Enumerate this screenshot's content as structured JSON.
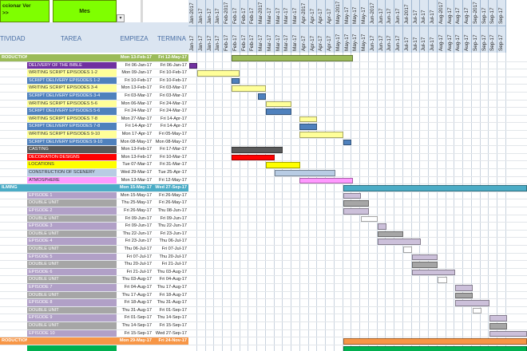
{
  "toolbar": {
    "select_view_label": "ccionar Ver\n>>",
    "view_value": "Mes",
    "dropdown_icon": "chevron-down-icon"
  },
  "columns": {
    "activity": "TIVIDAD",
    "task": "TAREA",
    "start": "EMPIEZA",
    "end": "TERMINA"
  },
  "months": [
    "Jan-2017",
    "Jan-17",
    "Jan-17",
    "Jan-17",
    "Feb-2017",
    "Feb-17",
    "Feb-17",
    "Feb-17",
    "Mar-2017",
    "Mar-17",
    "Mar-17",
    "Mar-17",
    "Mar-17",
    "Apr-2017",
    "Apr-17",
    "Apr-17",
    "Apr-17",
    "May-2017",
    "May-17",
    "May-17",
    "May-17",
    "Jun-2017",
    "Jun-17",
    "Jun-17",
    "Jun-17",
    "Jul-2017",
    "Jul-17",
    "Jul-17",
    "Jul-17",
    "Aug-2017",
    "Aug-17",
    "Aug-17",
    "Aug-17",
    "Sep-2017",
    "Sep-17",
    "Sep-17",
    "Sep-17"
  ],
  "months2": [
    "Jan-17",
    "Jan-17",
    "Jan-17",
    "Jan-17",
    "Feb-17",
    "Feb-17",
    "Feb-17",
    "Feb-17",
    "Mar-17",
    "Mar-17",
    "Mar-17",
    "Mar-17",
    "Mar-17",
    "Apr-17",
    "Apr-17",
    "Apr-17",
    "Apr-17",
    "May-17",
    "May-17",
    "May-17",
    "May-17",
    "Jun-17",
    "Jun-17",
    "Jun-17",
    "Jun-17",
    "Jul-17",
    "Jul-17",
    "Jul-17",
    "Jul-17",
    "Aug-17",
    "Aug-17",
    "Aug-17",
    "Aug-17",
    "Sep-17",
    "Sep-17",
    "Sep-17",
    "Sep-17"
  ],
  "rows": [
    {
      "activity": "RODUCTION",
      "task": "",
      "start": "Mon 13-Feb-17",
      "end": "Fri 12-May-17",
      "kind": "phase",
      "color": "#9bbb59",
      "bar": [
        290,
        442
      ],
      "barColor": "#9bbb59"
    },
    {
      "activity": "",
      "task": "DELIVERY OF THE BIBLE",
      "start": "Fri 06-Jan-17",
      "end": "Fri 06-Jan-17",
      "color": "#7030a0",
      "bar": [
        237,
        247
      ],
      "barColor": "#7030a0"
    },
    {
      "activity": "",
      "task": "WRITING SCRIPT EPISODES 1-2",
      "start": "Mon 09-Jan-17",
      "end": "Fri 10-Feb-17",
      "color": "#ffff99",
      "bar": [
        247,
        300
      ],
      "barColor": "#ffff99"
    },
    {
      "activity": "",
      "task": "SCRIPT DELIVERY EPISODES 1-2",
      "start": "Fri 10-Feb-17",
      "end": "Fri 10-Feb-17",
      "color": "#4f81bd",
      "bar": [
        290,
        300
      ],
      "barColor": "#4f81bd"
    },
    {
      "activity": "",
      "task": "WRITING SCRIPT EPISODES 3-4",
      "start": "Mon 13-Feb-17",
      "end": "Fri 03-Mar-17",
      "color": "#ffff99",
      "bar": [
        290,
        333
      ],
      "barColor": "#ffff99"
    },
    {
      "activity": "",
      "task": "SCRIPT DELIVERY EPISODES 3-4",
      "start": "Fri 03-Mar-17",
      "end": "Fri 03-Mar-17",
      "color": "#4f81bd",
      "bar": [
        323,
        333
      ],
      "barColor": "#4f81bd"
    },
    {
      "activity": "",
      "task": "WRITING SCRIPT EPISODES 5-6",
      "start": "Mon 06-Mar-17",
      "end": "Fri 24-Mar-17",
      "color": "#ffff99",
      "bar": [
        333,
        365
      ],
      "barColor": "#ffff99"
    },
    {
      "activity": "",
      "task": "SCRIPT DELIVERY EPISODES 5-6",
      "start": "Fri 24-Mar-17",
      "end": "Fri 24-Mar-17",
      "color": "#4f81bd",
      "bar": [
        333,
        365
      ],
      "barColor": "#4f81bd"
    },
    {
      "activity": "",
      "task": "WRITING SCRIPT EPISODES 7-8",
      "start": "Mon 27-Mar-17",
      "end": "Fri 14-Apr-17",
      "color": "#ffff99",
      "bar": [
        375,
        397
      ],
      "barColor": "#ffff99"
    },
    {
      "activity": "",
      "task": "SCRIPT DELIVERY EPISODES 7-8",
      "start": "Fri 14-Apr-17",
      "end": "Fri 14-Apr-17",
      "color": "#4f81bd",
      "bar": [
        375,
        397
      ],
      "barColor": "#4f81bd"
    },
    {
      "activity": "",
      "task": "WRITING SCRIPT EPISODES 9-10",
      "start": "Mon 17-Apr-17",
      "end": "Fri 05-May-17",
      "color": "#ffff99",
      "bar": [
        375,
        430
      ],
      "barColor": "#ffff99"
    },
    {
      "activity": "",
      "task": "SCRIPT DELIVERY EPISODES 9-10",
      "start": "Mon 08-May-17",
      "end": "Mon 08-May-17",
      "color": "#4f81bd",
      "bar": [
        430,
        440
      ],
      "barColor": "#4f81bd"
    },
    {
      "activity": "",
      "task": "CASTING",
      "start": "Mon 13-Feb-17",
      "end": "Fri 17-Mar-17",
      "color": "#595959",
      "bar": [
        290,
        354
      ],
      "barColor": "#595959"
    },
    {
      "activity": "",
      "task": "DECORATION DESIGNS",
      "start": "Mon 13-Feb-17",
      "end": "Fri 10-Mar-17",
      "color": "#ff0000",
      "bar": [
        290,
        344
      ],
      "barColor": "#ff0000"
    },
    {
      "activity": "",
      "task": "LOCATIONS",
      "start": "Tue 07-Mar-17",
      "end": "Fri 31-Mar-17",
      "color": "#ffff00",
      "bar": [
        333,
        376
      ],
      "barColor": "#ffff00"
    },
    {
      "activity": "",
      "task": "CONSTRUCTION OF SCENERY",
      "start": "Wed 29-Mar-17",
      "end": "Tue 25-Apr-17",
      "color": "#b8cce4",
      "bar": [
        344,
        420
      ],
      "barColor": "#b8cce4"
    },
    {
      "activity": "",
      "task": "ATMOSPHERE",
      "start": "Mon 13-Mar-17",
      "end": "Fri 12-May-17",
      "color": "#ff99ff",
      "bar": [
        375,
        442
      ],
      "barColor": "#ff99ff"
    },
    {
      "activity": "ILMING",
      "task": "",
      "start": "Mon 15-May-17",
      "end": "Wed 27-Sep-17",
      "kind": "phase",
      "color": "#4bacc6",
      "bar": [
        430,
        660
      ],
      "barColor": "#4bacc6"
    },
    {
      "activity": "",
      "task": "EPISODE 1",
      "start": "Mon 15-May-17",
      "end": "Fri 26-May-17",
      "color": "#b1a0c7",
      "bar": [
        430,
        452
      ],
      "barColor": "#ccc0da"
    },
    {
      "activity": "",
      "task": "DOUBLE UNIT",
      "start": "Thu 25-May-17",
      "end": "Fri 26-May-17",
      "color": "#a6a6a6",
      "bar": [
        430,
        462
      ],
      "barColor": "#a6a6a6"
    },
    {
      "activity": "",
      "task": "EPISODE 2",
      "start": "Fri 26-May-17",
      "end": "Thu 08-Jun-17",
      "color": "#b1a0c7",
      "bar": [
        430,
        462
      ],
      "barColor": "#ccc0da"
    },
    {
      "activity": "",
      "task": "DOUBLE UNIT",
      "start": "Fri 09-Jun-17",
      "end": "Fri 09-Jun-17",
      "color": "#a6a6a6",
      "bar": [
        452,
        473
      ],
      "barColor": "#ffffff"
    },
    {
      "activity": "",
      "task": "EPISODE 3",
      "start": "Fri 09-Jun-17",
      "end": "Thu 22-Jun-17",
      "color": "#b1a0c7",
      "bar": [
        473,
        484
      ],
      "barColor": "#ccc0da"
    },
    {
      "activity": "",
      "task": "DOUBLE UNIT",
      "start": "Thu 22-Jun-17",
      "end": "Fri 23-Jun-17",
      "color": "#a6a6a6",
      "bar": [
        473,
        505
      ],
      "barColor": "#a6a6a6"
    },
    {
      "activity": "",
      "task": "EPISODE 4",
      "start": "Fri 23-Jun-17",
      "end": "Thu 06-Jul-17",
      "color": "#b1a0c7",
      "bar": [
        473,
        527
      ],
      "barColor": "#ccc0da"
    },
    {
      "activity": "",
      "task": "DOUBLE UNIT",
      "start": "Thu 06-Jul-17",
      "end": "Fri 07-Jul-17",
      "color": "#a6a6a6",
      "bar": [
        505,
        516
      ],
      "barColor": "#ffffff"
    },
    {
      "activity": "",
      "task": "EPISODE 5",
      "start": "Fri 07-Jul-17",
      "end": "Thu 20-Jul-17",
      "color": "#b1a0c7",
      "bar": [
        516,
        548
      ],
      "barColor": "#ccc0da"
    },
    {
      "activity": "",
      "task": "DOUBLE UNIT",
      "start": "Thu 20-Jul-17",
      "end": "Fri 21-Jul-17",
      "color": "#a6a6a6",
      "bar": [
        516,
        548
      ],
      "barColor": "#a6a6a6"
    },
    {
      "activity": "",
      "task": "EPISODE 6",
      "start": "Fri 21-Jul-17",
      "end": "Thu 03-Aug-17",
      "color": "#b1a0c7",
      "bar": [
        516,
        570
      ],
      "barColor": "#ccc0da"
    },
    {
      "activity": "",
      "task": "DOUBLE UNIT",
      "start": "Thu 03-Aug-17",
      "end": "Fri 04-Aug-17",
      "color": "#a6a6a6",
      "bar": [
        548,
        560
      ],
      "barColor": "#ffffff"
    },
    {
      "activity": "",
      "task": "EPISODE 7",
      "start": "Fri 04-Aug-17",
      "end": "Thu 17-Aug-17",
      "color": "#b1a0c7",
      "bar": [
        570,
        592
      ],
      "barColor": "#ccc0da"
    },
    {
      "activity": "",
      "task": "DOUBLE UNIT",
      "start": "Thu 17-Aug-17",
      "end": "Fri 18-Aug-17",
      "color": "#a6a6a6",
      "bar": [
        570,
        592
      ],
      "barColor": "#a6a6a6"
    },
    {
      "activity": "",
      "task": "EPISODE 8",
      "start": "Fri 18-Aug-17",
      "end": "Thu 31-Aug-17",
      "color": "#b1a0c7",
      "bar": [
        570,
        613
      ],
      "barColor": "#ccc0da"
    },
    {
      "activity": "",
      "task": "DOUBLE UNIT",
      "start": "Thu 31-Aug-17",
      "end": "Fri 01-Sep-17",
      "color": "#a6a6a6",
      "bar": [
        592,
        603
      ],
      "barColor": "#ffffff"
    },
    {
      "activity": "",
      "task": "EPISODE 9",
      "start": "Fri 01-Sep-17",
      "end": "Thu 14-Sep-17",
      "color": "#b1a0c7",
      "bar": [
        613,
        635
      ],
      "barColor": "#ccc0da"
    },
    {
      "activity": "",
      "task": "DOUBLE UNIT",
      "start": "Thu 14-Sep-17",
      "end": "Fri 15-Sep-17",
      "color": "#a6a6a6",
      "bar": [
        613,
        635
      ],
      "barColor": "#a6a6a6"
    },
    {
      "activity": "",
      "task": "EPISODE 10",
      "start": "Fri 15-Sep-17",
      "end": "Wed 27-Sep-17",
      "color": "#b1a0c7",
      "bar": [
        613,
        660
      ],
      "barColor": "#ccc0da"
    },
    {
      "activity": "RODUCTION",
      "task": "",
      "start": "Mon 29-May-17",
      "end": "Fri 24-Nov-17",
      "kind": "phase",
      "color": "#f79646",
      "bar": [
        430,
        660
      ],
      "barColor": "#f79646"
    },
    {
      "activity": "",
      "task": "",
      "start": "",
      "end": "",
      "color": "#00b050",
      "bar": [
        430,
        660
      ],
      "barColor": "#00b050"
    }
  ]
}
